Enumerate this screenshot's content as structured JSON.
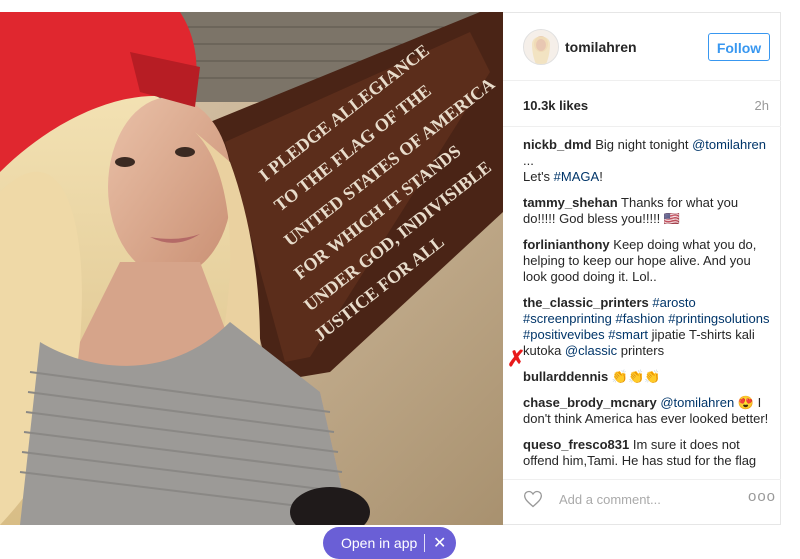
{
  "post": {
    "username": "tomilahren",
    "follow_label": "Follow",
    "likes": "10.3k likes",
    "time": "2h",
    "add_comment_placeholder": "Add a comment...",
    "more_label": "ooo"
  },
  "photo": {
    "banner_text": [
      "I PLEDGE ALLEGIANCE",
      "TO THE FLAG OF THE",
      "UNITED STATES OF AMERICA",
      "FOR WHICH IT STANDS",
      "UNDER GOD, INDIVISIBLE",
      "JUSTICE FOR ALL"
    ]
  },
  "comments": [
    {
      "user": "nickb_dmd",
      "text": " Big night tonight ",
      "mention": "@tomilahren",
      "text2": " ...",
      "line2_prefix": "Let's ",
      "hashtag": "#MAGA",
      "line2_suffix": "!"
    },
    {
      "user": "tammy_shehan",
      "text": " Thanks for what you do!!!!! God bless you!!!!! 🇺🇸"
    },
    {
      "user": "forlinianthony",
      "text": " Keep doing what you do, helping to keep our hope alive. And you look good doing it. Lol.."
    },
    {
      "user": "the_classic_printers",
      "tags": [
        "#arosto",
        "#screenprinting",
        "#fashion",
        "#printingsolutions",
        "#positivevibes",
        "#smart"
      ],
      "text": " jipatie T-shirts kali kutoka ",
      "mention": "@classic",
      "text2": " printers"
    },
    {
      "user": "bullarddennis",
      "text": " 👏👏👏"
    },
    {
      "user": "chase_brody_mcnary",
      "mention": "@tomilahren",
      "text": " 😍 I don't think America has ever looked better!"
    },
    {
      "user": "queso_fresco831",
      "text": " Im sure it does not offend him,Tami. He has stud for the flag and now by sitting or taking a knee he is also standing for the flag. There were no bottles hurled or windows broken. I can proudly"
    }
  ],
  "annotation": {
    "mark": "✗"
  },
  "open_app": {
    "label": "Open in app",
    "close": "✕"
  },
  "colors": {
    "accent": "#3897f0",
    "pill": "#6a5fd6",
    "link": "#003569",
    "cap": "#e0272f",
    "annotation": "#e8191a"
  }
}
